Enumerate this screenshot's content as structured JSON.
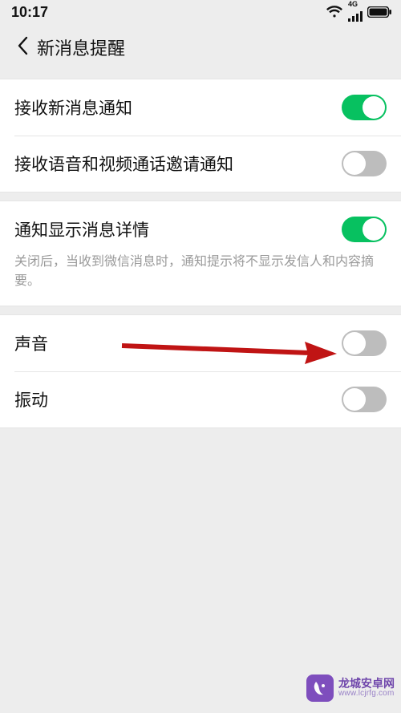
{
  "status_bar": {
    "time": "10:17",
    "network_label": "4G"
  },
  "header": {
    "title": "新消息提醒"
  },
  "groups": [
    {
      "rows": [
        {
          "label": "接收新消息通知",
          "on": true
        },
        {
          "label": "接收语音和视频通话邀请通知",
          "on": false
        }
      ]
    },
    {
      "rows": [
        {
          "label": "通知显示消息详情",
          "on": true
        }
      ],
      "description": "关闭后，当收到微信消息时，通知提示将不显示发信人和内容摘要。"
    },
    {
      "rows": [
        {
          "label": "声音",
          "on": false
        },
        {
          "label": "振动",
          "on": false
        }
      ]
    }
  ],
  "colors": {
    "toggle_on": "#07c160",
    "toggle_off": "#bdbdbd",
    "bg": "#ededed",
    "annotation": "#c01414"
  },
  "watermark": {
    "line1": "龙城安卓网",
    "line2": "www.lcjrfg.com"
  }
}
